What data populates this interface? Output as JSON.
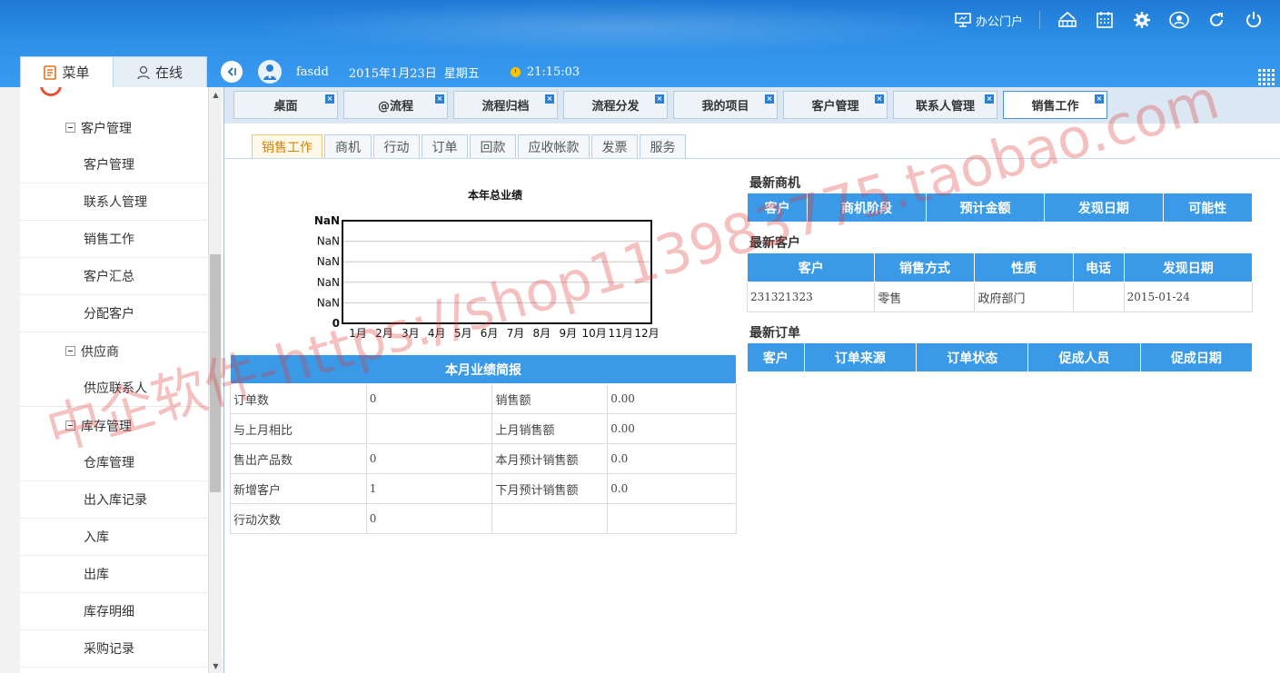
{
  "header": {
    "portal_label": "办公门户",
    "icons": [
      "desk-icon",
      "calendar-icon",
      "gear-icon",
      "user-circle-icon",
      "refresh-icon",
      "power-icon"
    ]
  },
  "left_tabs": {
    "menu_label": "菜单",
    "online_label": "在线"
  },
  "userbar": {
    "username": "fasdd",
    "date": "2015年1月23日",
    "weekday": "星期五",
    "time": "21:15:03"
  },
  "sidebar": {
    "groups": [
      {
        "label": "客户管理",
        "items": [
          "客户管理",
          "联系人管理",
          "销售工作",
          "客户汇总",
          "分配客户"
        ]
      },
      {
        "label": "供应商",
        "items": [
          "供应联系人"
        ]
      },
      {
        "label": "库存管理",
        "items": [
          "仓库管理",
          "出入库记录",
          "入库",
          "出库",
          "库存明细",
          "采购记录"
        ]
      }
    ]
  },
  "window_tabs": [
    "桌面",
    "@流程",
    "流程归档",
    "流程分发",
    "我的项目",
    "客户管理",
    "联系人管理",
    "销售工作"
  ],
  "window_tab_close": "×",
  "sub_tabs": [
    "销售工作",
    "商机",
    "行动",
    "订单",
    "回款",
    "应收帐款",
    "发票",
    "服务"
  ],
  "chart_data": {
    "type": "line",
    "title": "本年总业绩",
    "categories": [
      "1月",
      "2月",
      "3月",
      "4月",
      "5月",
      "6月",
      "7月",
      "8月",
      "9月",
      "10月",
      "11月",
      "12月"
    ],
    "y_tick_labels": [
      "NaN",
      "NaN",
      "NaN",
      "NaN",
      "NaN",
      "0"
    ],
    "series": []
  },
  "monthly_report": {
    "title": "本月业绩简报",
    "rows": [
      {
        "label1": "订单数",
        "value1": "0",
        "label2": "销售额",
        "value2": "0.00"
      },
      {
        "label1": "与上月相比",
        "value1": "",
        "label2": "上月销售额",
        "value2": "0.00"
      },
      {
        "label1": "售出产品数",
        "value1": "0",
        "label2": "本月预计销售额",
        "value2": "0.0"
      },
      {
        "label1": "新增客户",
        "value1": "1",
        "label2": "下月预计销售额",
        "value2": "0.0"
      },
      {
        "label1": "行动次数",
        "value1": "0",
        "label2": "",
        "value2": ""
      }
    ]
  },
  "latest_opportunities": {
    "title": "最新商机",
    "columns": [
      "客户",
      "商机阶段",
      "预计金额",
      "发现日期",
      "可能性"
    ]
  },
  "latest_customers": {
    "title": "最新客户",
    "columns": [
      "客户",
      "销售方式",
      "性质",
      "电话",
      "发现日期"
    ],
    "rows": [
      {
        "customer": "231321323",
        "method": "零售",
        "nature": "政府部门",
        "phone": "",
        "date": "2015-01-24"
      }
    ]
  },
  "latest_orders": {
    "title": "最新订单",
    "columns": [
      "客户",
      "订单来源",
      "订单状态",
      "促成人员",
      "促成日期"
    ]
  },
  "watermark": "中企软件-https://shop113983775.taobao.com"
}
